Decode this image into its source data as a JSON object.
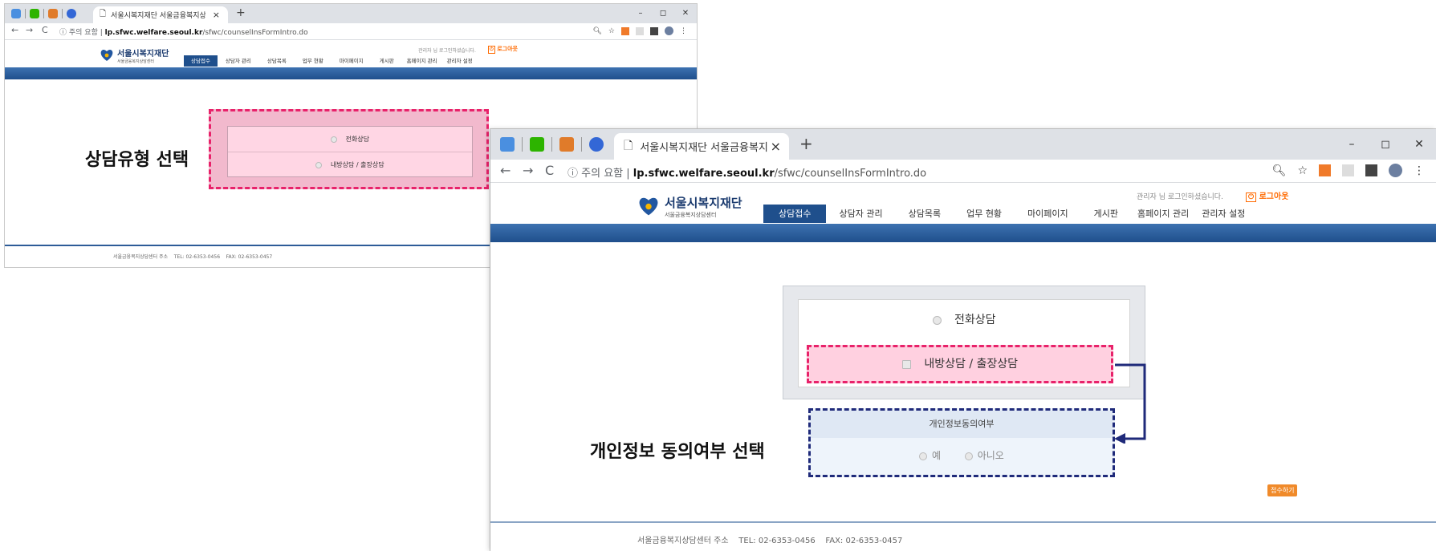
{
  "browser": {
    "tab_title": "서울시복지재단 서울금융복지상",
    "tab_close": "×",
    "new_tab": "+",
    "window_controls": [
      "–",
      "◻",
      "✕"
    ],
    "security_label": "주의 요함",
    "url_domain": "lp.sfwc.welfare.seoul.kr",
    "url_path": "/sfwc/counselInsFormIntro.do"
  },
  "site": {
    "logo_title": "서울시복지재단",
    "logo_subtitle": "서울금융복지상담센터",
    "login_message": "관리자 님 로그인하셨습니다.",
    "logout_label": "로그아웃",
    "nav": [
      "상담접수",
      "상담자 관리",
      "상담목록",
      "업무 현황",
      "마이페이지",
      "게시판",
      "홈페이지 관리",
      "관리자 설정"
    ],
    "counsel_options": [
      "전화상담",
      "내방상담 / 출장상담"
    ],
    "consent_title": "개인정보동의여부",
    "consent_yes": "예",
    "consent_no": "아니오",
    "submit_label": "접수하기",
    "footer_text": "서울금융복지상담센터 주소    TEL: 02-6353-0456    FAX: 02-6353-0457"
  },
  "annotations": {
    "counsel_type": "상담유형 선택",
    "privacy_consent": "개인정보 동의여부 선택"
  },
  "colors": {
    "nav_active": "#1f4f8c",
    "pink_highlight": "#ffd0e0",
    "pink_border": "#e8226a",
    "navy_border": "#1f2a7a",
    "logout_accent": "#ff6a00"
  }
}
